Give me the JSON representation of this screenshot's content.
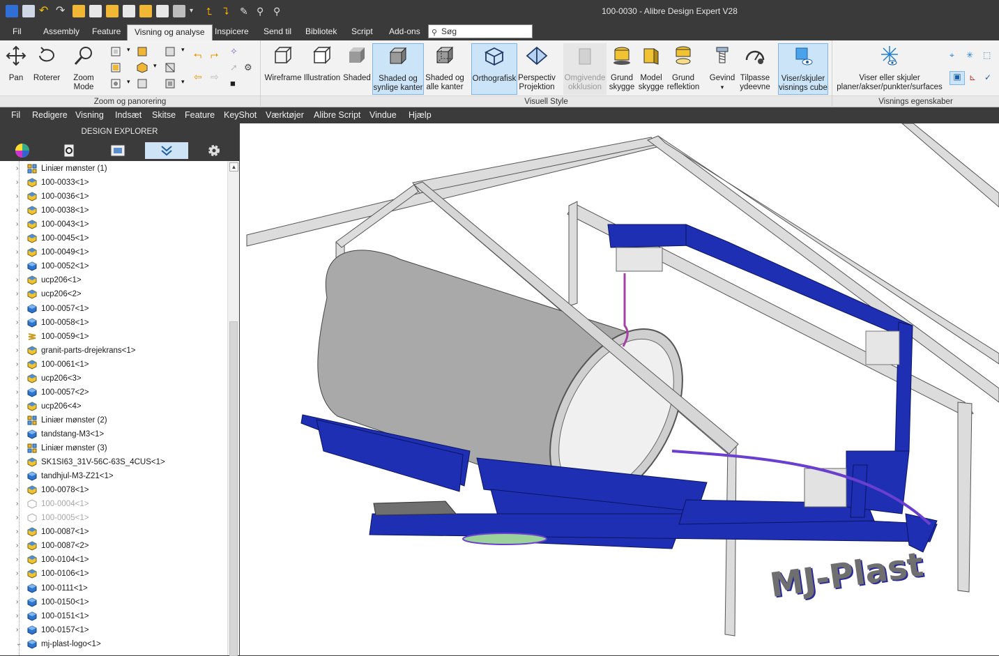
{
  "window": {
    "title": "100-0030 - Alibre Design Expert V28"
  },
  "ribbon_tabs": [
    {
      "label": "Fil"
    },
    {
      "label": "Assembly"
    },
    {
      "label": "Feature"
    },
    {
      "label": "Visning og analyse",
      "active": true
    },
    {
      "label": "Inspicere"
    },
    {
      "label": "Send til"
    },
    {
      "label": "Bibliotek"
    },
    {
      "label": "Script"
    },
    {
      "label": "Add-ons"
    }
  ],
  "search": {
    "placeholder": "Søg"
  },
  "ribbon": {
    "zoom_group": {
      "label": "Zoom og panorering",
      "buttons": [
        {
          "label": "Pan"
        },
        {
          "label": "Roterer"
        },
        {
          "label": "Zoom Mode"
        }
      ]
    },
    "visual_group": {
      "label": "Visuell Style",
      "buttons": [
        {
          "label1": "Wireframe",
          "label2": ""
        },
        {
          "label1": "Illustration",
          "label2": ""
        },
        {
          "label1": "Shaded",
          "label2": ""
        },
        {
          "label1": "Shaded og",
          "label2": "synlige kanter"
        },
        {
          "label1": "Shaded og",
          "label2": "alle kanter"
        },
        {
          "label1": "Orthografisk",
          "label2": ""
        },
        {
          "label1": "Perspectiv",
          "label2": "Projektion"
        },
        {
          "label1": "Omgivende",
          "label2": "okklusion"
        },
        {
          "label1": "Grund",
          "label2": "skygge"
        },
        {
          "label1": "Model",
          "label2": "skygge"
        },
        {
          "label1": "Grund",
          "label2": "reflektion"
        },
        {
          "label1": "Gevind",
          "label2": ""
        },
        {
          "label1": "Tilpasse",
          "label2": "ydeevne"
        },
        {
          "label1": "Viser/skjuler",
          "label2": "visnings cube"
        }
      ]
    },
    "view_props_group": {
      "label": "Visnings egenskaber",
      "buttons": [
        {
          "label1": "Viser eller skjuler",
          "label2": "planer/akser/punkter/surfaces"
        }
      ]
    }
  },
  "menubar": [
    {
      "label": "Fil"
    },
    {
      "label": "Redigere"
    },
    {
      "label": "Visning"
    },
    {
      "label": "Indsæt"
    },
    {
      "label": "Skitse"
    },
    {
      "label": "Feature"
    },
    {
      "label": "KeyShot"
    },
    {
      "label": "Værktøjer"
    },
    {
      "label": "Alibre Script"
    },
    {
      "label": "Vindue"
    },
    {
      "label": "Hjælp"
    }
  ],
  "explorer": {
    "title": "DESIGN EXPLORER",
    "items": [
      {
        "label": "Liniær mønster (1)",
        "icon": "pattern-icon"
      },
      {
        "label": "100-0033<1>",
        "icon": "part-icon"
      },
      {
        "label": "100-0036<1>",
        "icon": "part-icon"
      },
      {
        "label": "100-0038<1>",
        "icon": "part-icon"
      },
      {
        "label": "100-0043<1>",
        "icon": "part-icon"
      },
      {
        "label": "100-0045<1>",
        "icon": "part-icon"
      },
      {
        "label": "100-0049<1>",
        "icon": "part-icon"
      },
      {
        "label": "100-0052<1>",
        "icon": "part-blue-icon"
      },
      {
        "label": "ucp206<1>",
        "icon": "part-icon"
      },
      {
        "label": "ucp206<2>",
        "icon": "part-icon"
      },
      {
        "label": "100-0057<1>",
        "icon": "part-blue-icon"
      },
      {
        "label": "100-0058<1>",
        "icon": "part-blue-icon"
      },
      {
        "label": "100-0059<1>",
        "icon": "spring-icon"
      },
      {
        "label": "granit-parts-drejekrans<1>",
        "icon": "part-icon"
      },
      {
        "label": "100-0061<1>",
        "icon": "part-icon"
      },
      {
        "label": "ucp206<3>",
        "icon": "part-icon"
      },
      {
        "label": "100-0057<2>",
        "icon": "part-blue-icon"
      },
      {
        "label": "ucp206<4>",
        "icon": "part-icon"
      },
      {
        "label": "Liniær mønster (2)",
        "icon": "pattern-icon"
      },
      {
        "label": "tandstang-M3<1>",
        "icon": "part-blue-icon"
      },
      {
        "label": "Liniær mønster (3)",
        "icon": "pattern-icon"
      },
      {
        "label": "SK1SI63_31V-56C-63S_4CUS<1>",
        "icon": "part-icon"
      },
      {
        "label": "tandhjul-M3-Z21<1>",
        "icon": "part-blue-icon"
      },
      {
        "label": "100-0078<1>",
        "icon": "part-icon"
      },
      {
        "label": "100-0004<1>",
        "icon": "ghost-icon",
        "dim": true
      },
      {
        "label": "100-0005<1>",
        "icon": "ghost-icon",
        "dim": true
      },
      {
        "label": "100-0087<1>",
        "icon": "part-icon"
      },
      {
        "label": "100-0087<2>",
        "icon": "part-icon"
      },
      {
        "label": "100-0104<1>",
        "icon": "part-icon"
      },
      {
        "label": "100-0106<1>",
        "icon": "part-icon"
      },
      {
        "label": "100-0111<1>",
        "icon": "part-blue-icon"
      },
      {
        "label": "100-0150<1>",
        "icon": "part-blue-icon"
      },
      {
        "label": "100-0151<1>",
        "icon": "part-blue-icon"
      },
      {
        "label": "100-0157<1>",
        "icon": "part-blue-icon"
      },
      {
        "label": "mj-plast-logo<1>",
        "icon": "part-blue-icon",
        "expanded": true
      }
    ]
  },
  "viewport": {
    "logo_text": "MJ-Plast"
  },
  "colors": {
    "accent_blue": "#1e2fb4",
    "frame_gray": "#d4d4d4",
    "tube_gray": "#a8a8a8"
  }
}
